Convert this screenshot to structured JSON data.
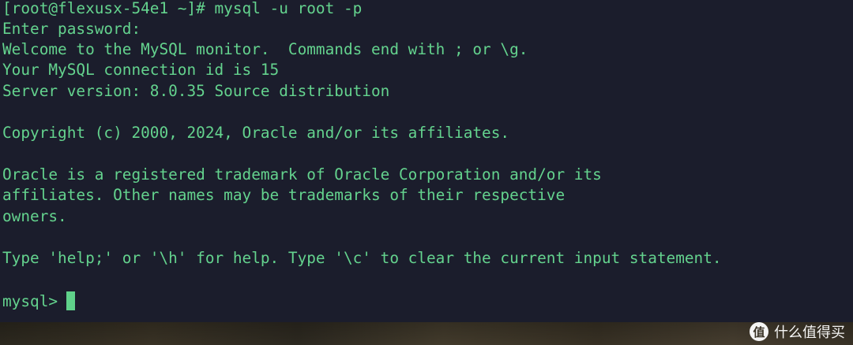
{
  "terminal": {
    "lines": [
      "[root@flexusx-54e1 ~]# mysql -u root -p",
      "Enter password:",
      "Welcome to the MySQL monitor.  Commands end with ; or \\g.",
      "Your MySQL connection id is 15",
      "Server version: 8.0.35 Source distribution",
      "",
      "Copyright (c) 2000, 2024, Oracle and/or its affiliates.",
      "",
      "Oracle is a registered trademark of Oracle Corporation and/or its",
      "affiliates. Other names may be trademarks of their respective",
      "owners.",
      "",
      "Type 'help;' or '\\h' for help. Type '\\c' to clear the current input statement."
    ],
    "prompt": "mysql>",
    "text_color": "#64d38e",
    "background_color": "#1b1d2c"
  },
  "watermark": {
    "logo_glyph": "值",
    "text": "什么值得买"
  }
}
